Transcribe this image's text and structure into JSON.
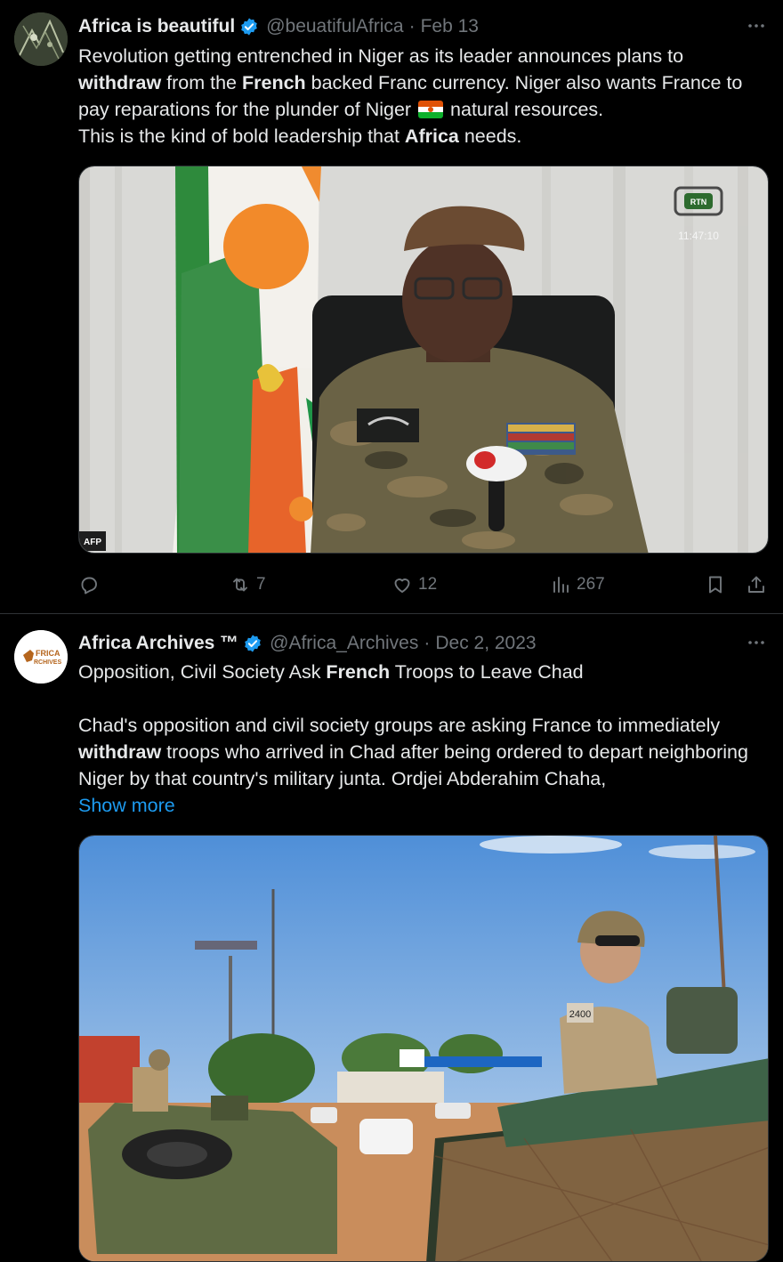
{
  "tweets": [
    {
      "name": "Africa is beautiful",
      "handle": "@beuatifulAfrica",
      "sep": "·",
      "date": "Feb 13",
      "text": {
        "p1_a": "Revolution getting entrenched in Niger as its leader announces plans to ",
        "p1_b": "withdraw",
        "p1_c": " from the ",
        "p1_d": "French",
        "p1_e": " backed Franc currency. Niger also wants France to pay reparations for the plunder of Niger ",
        "p1_f": " natural resources.",
        "p2_a": "This is the kind of bold leadership that ",
        "p2_b": "Africa",
        "p2_c": " needs."
      },
      "media_watermark": "AFP",
      "media_broadcaster": "RTN",
      "media_time": "11:47:10",
      "replies": "",
      "reposts": "7",
      "likes": "12",
      "views": "267"
    },
    {
      "name": "Africa Archives ™",
      "handle": "@Africa_Archives",
      "sep": "·",
      "date": "Dec 2, 2023",
      "avatar_text": "AFRICA ARCHIVES",
      "text": {
        "p1_a": "Opposition, Civil Society Ask ",
        "p1_b": "French",
        "p1_c": " Troops to Leave Chad",
        "p2_a": "Chad's opposition and civil society groups are asking France to immediately ",
        "p2_b": "withdraw",
        "p2_c": " troops who arrived in Chad after being ordered to depart neighboring Niger by that country's military junta. Ordjei Abderahim Chaha,",
        "show_more": "Show more"
      },
      "media_vehicle_label": "2400"
    }
  ],
  "colors": {
    "background": "#000000",
    "text": "#e7e9ea",
    "muted": "#71767b",
    "link": "#1d9bf0",
    "verified": "#1d9bf0",
    "divider": "#2f3336"
  },
  "icons": [
    "more-icon",
    "verified-badge-icon",
    "reply-icon",
    "repost-icon",
    "like-icon",
    "views-icon",
    "bookmark-icon",
    "share-icon",
    "niger-flag-icon"
  ]
}
